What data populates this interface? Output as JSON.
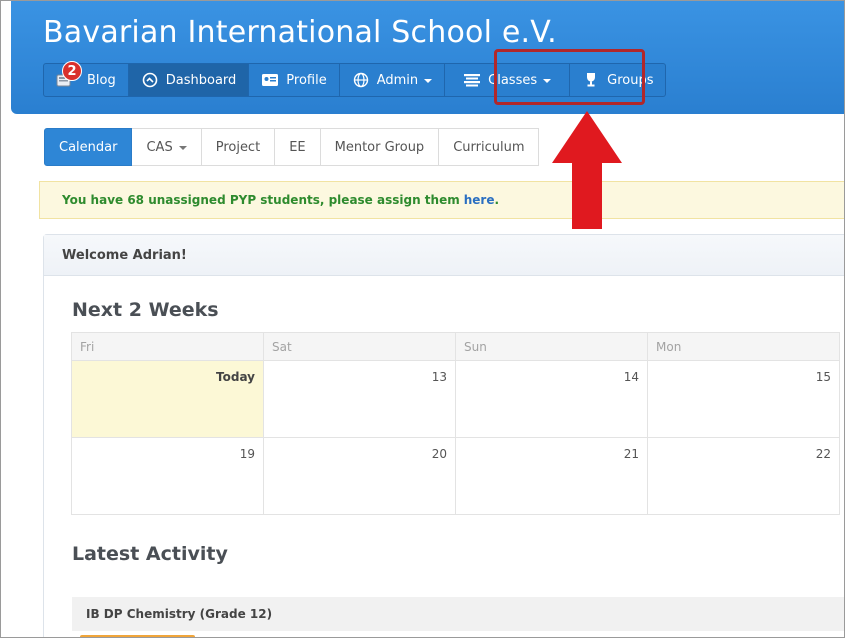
{
  "header": {
    "title": "Bavarian International School e.V."
  },
  "nav": {
    "blog": {
      "label": "Blog",
      "badge": "2"
    },
    "dashboard": {
      "label": "Dashboard"
    },
    "profile": {
      "label": "Profile"
    },
    "admin": {
      "label": "Admin"
    },
    "classes": {
      "label": "Classes"
    },
    "groups": {
      "label": "Groups"
    }
  },
  "subtabs": [
    "Calendar",
    "CAS",
    "Project",
    "EE",
    "Mentor Group",
    "Curriculum"
  ],
  "alert": {
    "text": "You have 68 unassigned PYP students, please assign them",
    "link": "here",
    "suffix": "."
  },
  "panel": {
    "welcome": "Welcome Adrian!"
  },
  "calendar": {
    "title": "Next 2 Weeks",
    "days": [
      "Fri",
      "Sat",
      "Sun",
      "Mon"
    ],
    "week1": [
      "Today",
      "13",
      "14",
      "15"
    ],
    "week2": [
      "19",
      "20",
      "21",
      "22"
    ]
  },
  "activity": {
    "title": "Latest Activity",
    "items": [
      "IB DP Chemistry (Grade 12)"
    ]
  },
  "colors": {
    "header": "#2a7fd0",
    "highlight": "#b1272a",
    "arrow": "#e0191f",
    "alert_text": "#2e8b2e"
  }
}
